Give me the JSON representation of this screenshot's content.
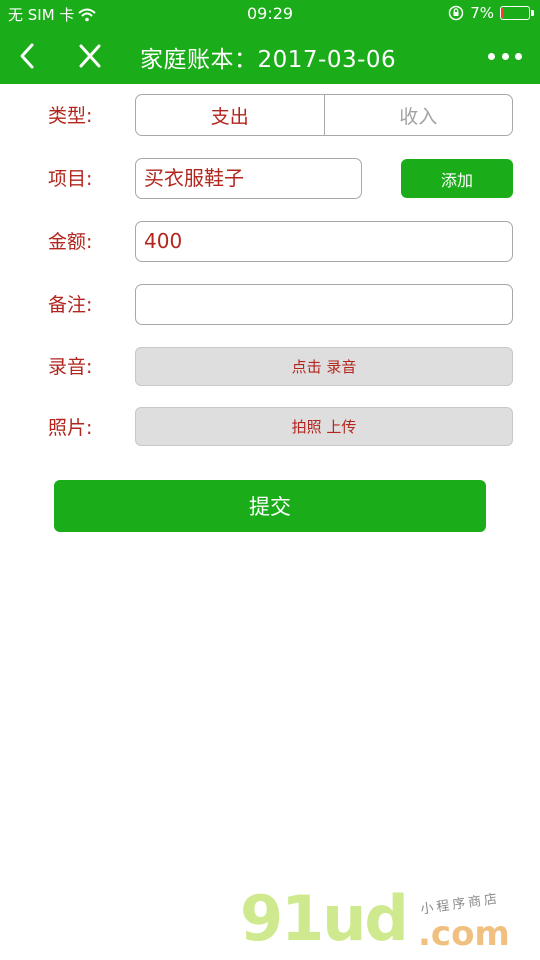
{
  "status_bar": {
    "carrier": "无 SIM 卡",
    "time": "09:29",
    "battery_percent": "7%",
    "battery_level": 0.07
  },
  "nav": {
    "title": "家庭账本：2017-03-06"
  },
  "form": {
    "type_label": "类型:",
    "type_options": [
      "支出",
      "收入"
    ],
    "item_label": "项目:",
    "item_value": "买衣服鞋子",
    "add_button": "添加",
    "amount_label": "金额:",
    "amount_value": "400",
    "note_label": "备注:",
    "note_value": "",
    "record_label": "录音:",
    "record_button": "点击 录音",
    "photo_label": "照片:",
    "photo_button": "拍照 上传",
    "submit_button": "提交"
  },
  "watermark": {
    "brand": "91ud",
    "domain": ".com",
    "tagline": "小程序商店"
  },
  "colors": {
    "brand_green": "#1aad19",
    "label_red": "#b2261e"
  }
}
